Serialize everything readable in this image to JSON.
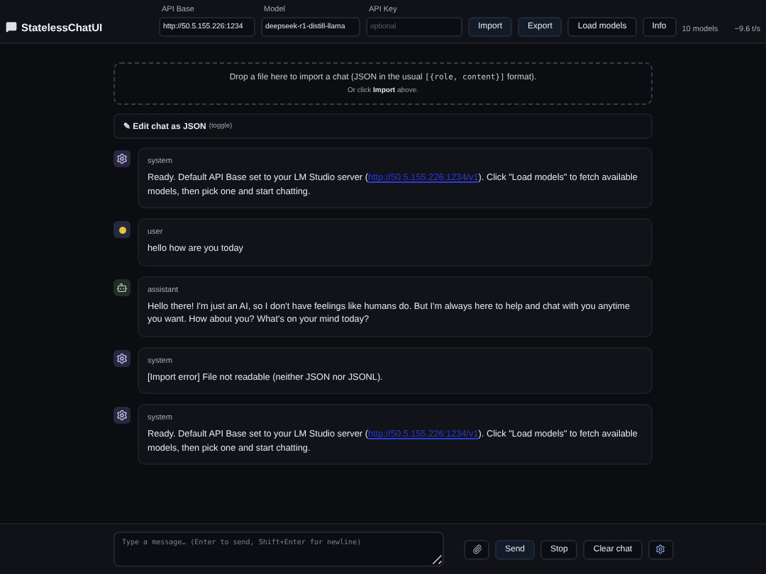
{
  "app": {
    "title": "StatelessChatUI"
  },
  "fields": [
    {
      "label": "API Base",
      "value": "http://50.5.155.226:1234"
    },
    {
      "label": "Model",
      "value": "deepseek-r1-distill-llama"
    },
    {
      "label": "API Key",
      "placeholder": "optional"
    }
  ],
  "header_buttons": [
    {
      "label": "Import",
      "primary": true
    },
    {
      "label": "Export",
      "primary": true
    },
    {
      "label": "Load models",
      "primary": false
    },
    {
      "label": "Info",
      "primary": false
    }
  ],
  "model_count": "10 models",
  "speed": "~9.6 t/s",
  "drop_zone": {
    "prefix": "Drop a file here to import a chat (JSON in the usual ",
    "code": "[{role, content}]",
    "suffix": " format).",
    "hint": "Or click **Import** above."
  },
  "editor_toggle": {
    "label": "✎ Edit chat as JSON",
    "hint": "(toggle)"
  },
  "messages": [
    {
      "role": "system",
      "text": "Ready. Default API Base set to your LM Studio server (",
      "link": "http://50.5.155.226:1234/v1",
      "after": "). Click \"Load models\" to fetch available models, then pick one and start chatting."
    },
    {
      "role": "user",
      "text": "hello how are you today"
    },
    {
      "role": "assistant",
      "text": "Hello there! I'm just an AI, so I don't have feelings like humans do. But I'm always here to help and chat with you anytime you want. How about you? What's on your mind today?"
    },
    {
      "role": "system",
      "text": "[Import error] File not readable (neither JSON nor JSONL)."
    },
    {
      "role": "system",
      "text": "Ready. Default API Base set to your LM Studio server (",
      "link": "http://50.5.155.226:1234/v1",
      "after": "). Click \"Load models\" to fetch available models, then pick one and start chatting."
    }
  ],
  "composer": {
    "placeholder": "Type a message… (Enter to send, Shift+Enter for newline)"
  },
  "composer_buttons": [
    {
      "kind": "attach"
    },
    {
      "kind": "text",
      "label": "Send",
      "primary": true
    },
    {
      "kind": "text",
      "label": "Stop",
      "primary": false
    },
    {
      "kind": "text",
      "label": "Clear chat",
      "primary": false
    },
    {
      "kind": "settings"
    }
  ]
}
